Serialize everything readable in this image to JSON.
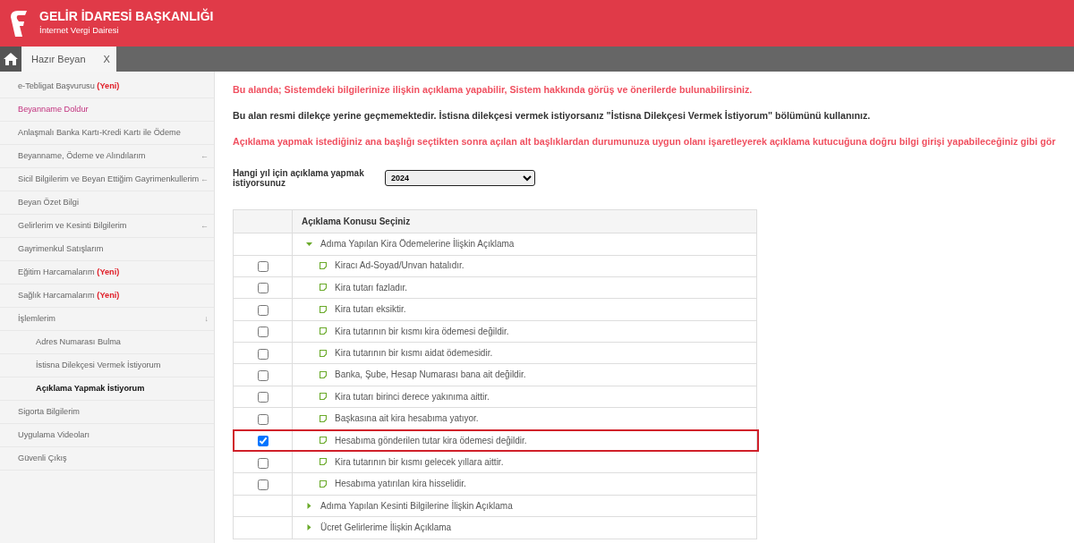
{
  "header": {
    "title": "GELİR İDARESİ BAŞKANLIĞI",
    "subtitle": "İnternet Vergi Dairesi"
  },
  "tabs": [
    {
      "label": "Hazır Beyan",
      "close": "X",
      "selected": true
    }
  ],
  "sidebar": {
    "items": [
      {
        "label": "e-Tebligat Başvurusu",
        "badge": "(Yeni)",
        "kind": "normal",
        "selected": false
      },
      {
        "label": "Beyanname Doldur",
        "kind": "featured",
        "selected": false
      },
      {
        "label": "Anlaşmalı Banka Kartı-Kredi Kartı ile Ödeme",
        "kind": "normal",
        "selected": false
      },
      {
        "label": "Beyanname, Ödeme ve Alındılarım",
        "arrow": "←",
        "kind": "normal",
        "selected": false
      },
      {
        "label": "Sicil Bilgilerim ve Beyan Ettiğim Gayrimenkullerim",
        "arrow": "←",
        "kind": "normal",
        "selected": false
      },
      {
        "label": "Beyan Özet Bilgi",
        "kind": "normal",
        "selected": false
      },
      {
        "label": "Gelirlerim ve Kesinti Bilgilerim",
        "arrow": "←",
        "kind": "normal",
        "selected": false
      },
      {
        "label": "Gayrimenkul Satışlarım",
        "kind": "normal",
        "selected": false
      },
      {
        "label": "Eğitim Harcamalarım",
        "badge": "(Yeni)",
        "kind": "normal",
        "selected": false
      },
      {
        "label": "Sağlık Harcamalarım",
        "badge": "(Yeni)",
        "kind": "normal",
        "selected": false
      },
      {
        "label": "İşlemlerim",
        "arrow": "↓",
        "kind": "normal",
        "selected": false,
        "children": [
          {
            "label": "Adres Numarası Bulma",
            "selected": false
          },
          {
            "label": "İstisna Dilekçesi Vermek İstiyorum",
            "selected": false
          },
          {
            "label": "Açıklama Yapmak İstiyorum",
            "selected": true
          }
        ]
      },
      {
        "label": "Sigorta Bilgilerim",
        "kind": "normal",
        "selected": false
      },
      {
        "label": "Uygulama Videoları",
        "kind": "normal",
        "selected": false
      },
      {
        "label": "Güvenli Çıkış",
        "kind": "normal",
        "selected": false
      }
    ]
  },
  "messages": [
    {
      "text": "Bu alanda; Sistemdeki bilgilerinize ilişkin açıklama yapabilir, Sistem hakkında görüş ve önerilerde bulunabilirsiniz.",
      "kind": "warning"
    },
    {
      "text": "Bu alan resmi dilekçe yerine geçmemektedir. İstisna dilekçesi vermek istiyorsanız \"İstisna Dilekçesi Vermek İstiyorum\" bölümünü kullanınız.",
      "kind": "info"
    },
    {
      "text": "Açıklama yapmak istediğiniz ana başlığı seçtikten sonra açılan alt başlıklardan durumunuza uygun olanı işaretleyerek açıklama kutucuğuna doğru bilgi girişi yapabileceğiniz gibi gör",
      "kind": "warning"
    }
  ],
  "year_field": {
    "label": "Hangi yıl için açıklama yapmak istiyorsunuz",
    "value": "2024"
  },
  "table": {
    "columns": [
      "Açıklama Konusu Seçiniz"
    ],
    "groups": [
      {
        "label": "Adıma Yapılan Kira Ödemelerine İlişkin Açıklama",
        "expanded": true,
        "children": [
          {
            "label": "Kiracı Ad-Soyad/Unvan hatalıdır.",
            "checked": false
          },
          {
            "label": "Kira tutarı fazladır.",
            "checked": false
          },
          {
            "label": "Kira tutarı eksiktir.",
            "checked": false
          },
          {
            "label": "Kira tutarının bir kısmı kira ödemesi değildir.",
            "checked": false
          },
          {
            "label": "Kira tutarının bir kısmı aidat ödemesidir.",
            "checked": false
          },
          {
            "label": "Banka, Şube, Hesap Numarası bana ait değildir.",
            "checked": false
          },
          {
            "label": "Kira tutarı birinci derece yakınıma aittir.",
            "checked": false
          },
          {
            "label": "Başkasına ait kira hesabıma yatıyor.",
            "checked": false
          },
          {
            "label": "Hesabıma gönderilen tutar kira ödemesi değildir.",
            "checked": true
          },
          {
            "label": "Kira tutarının bir kısmı gelecek yıllara aittir.",
            "checked": false
          },
          {
            "label": "Hesabıma yatırılan kira hisselidir.",
            "checked": false
          }
        ]
      },
      {
        "label": "Adıma Yapılan Kesinti Bilgilerine İlişkin Açıklama",
        "expanded": false
      },
      {
        "label": "Ücret Gelirlerime İlişkin Açıklama",
        "expanded": false
      }
    ]
  }
}
